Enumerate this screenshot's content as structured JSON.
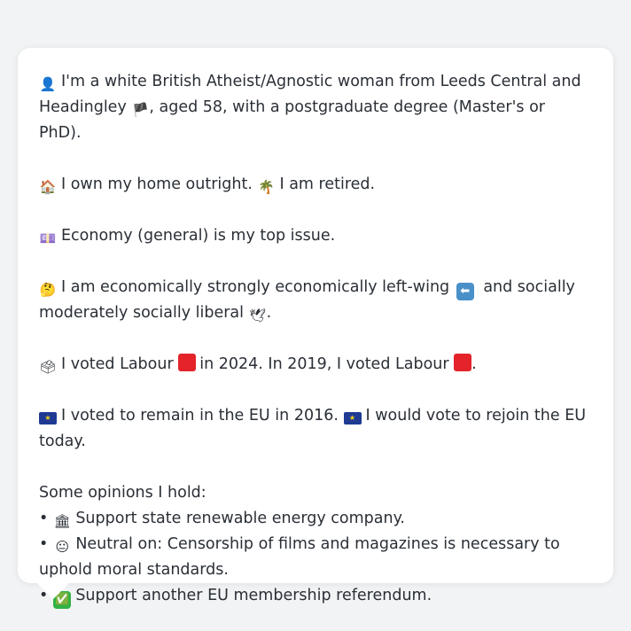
{
  "profile": {
    "line1_emoji": "👤",
    "line1_text_a": "I'm a white British Atheist/Agnostic woman from Leeds Central and Headingley",
    "line1_flag": "🏴",
    "line1_text_b": ", aged 58, with a postgraduate degree (Master's or PhD).",
    "home_emoji": "🏠",
    "home_text": "I own my home outright.",
    "retired_emoji": "🌴",
    "retired_text": "I am retired.",
    "issue_emoji": "💷",
    "issue_text": "Economy (general) is my top issue.",
    "politics_emoji": "🤔",
    "politics_text_a": "I am economically strongly economically left-wing",
    "politics_left_icon": "⬅",
    "politics_text_b": "and socially moderately socially liberal",
    "politics_dove_icon": "🕊",
    "politics_text_c": ".",
    "vote_emoji": "🗳",
    "vote_text_a": "I voted Labour",
    "vote_text_b": "in 2024. In 2019, I voted Labour",
    "vote_text_c": ".",
    "eu_text_a": "I voted to remain in the EU in 2016.",
    "eu_text_b": "I would vote to rejoin the EU today.",
    "eu_symbol": "★",
    "opinions_header": "Some opinions I hold:",
    "bullet": "•",
    "opinions": [
      {
        "emoji": "🏛",
        "text": "Support state renewable energy company."
      },
      {
        "emoji": "😐",
        "text": "Neutral on: Censorship of films and magazines is necessary to uphold moral standards."
      },
      {
        "emoji": "✅",
        "text": "Support another EU membership referendum."
      }
    ]
  },
  "colors": {
    "labour_red": "#e4232a",
    "eu_blue": "#1f3a93",
    "text": "#2a2f36",
    "card": "#ffffff",
    "background": "#f2f3f4"
  }
}
